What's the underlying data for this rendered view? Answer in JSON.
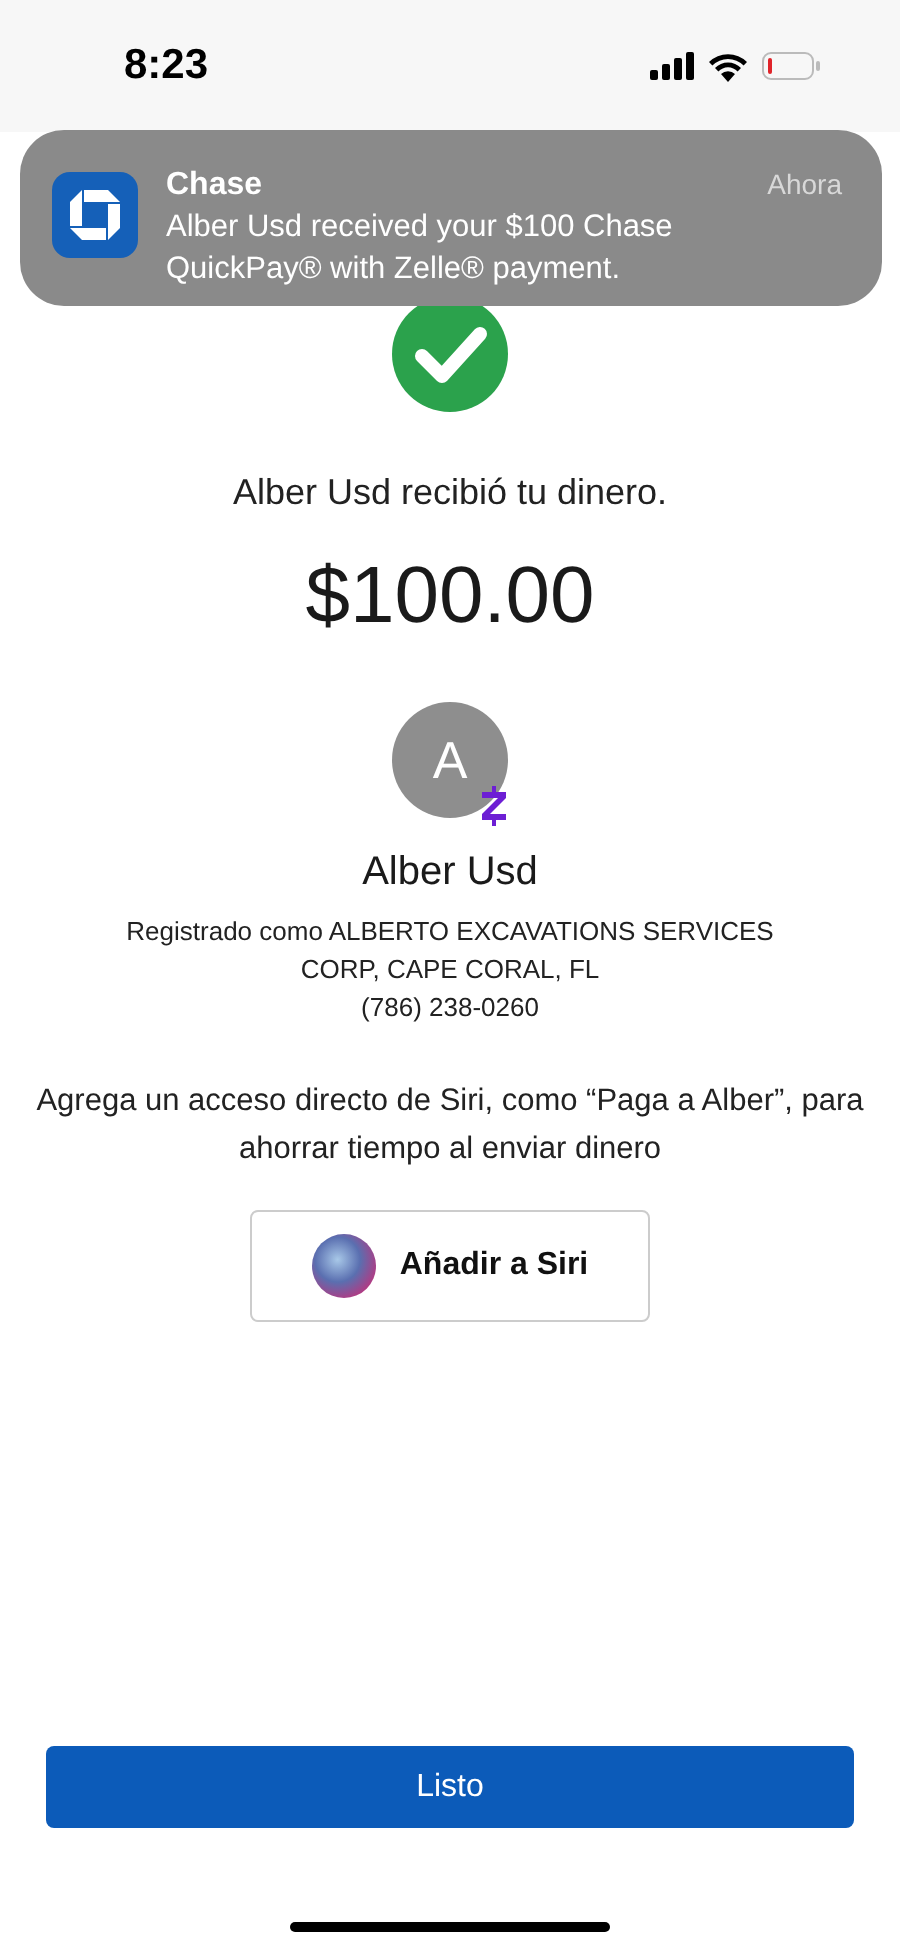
{
  "status_bar": {
    "time": "8:23"
  },
  "notification": {
    "app": "Chase",
    "time": "Ahora",
    "message": "Alber Usd received your $100 Chase QuickPay® with Zelle® payment."
  },
  "confirmation": {
    "message": "Alber Usd recibió tu dinero.",
    "amount": "$100.00"
  },
  "recipient": {
    "initial": "A",
    "name": "Alber Usd",
    "registered": "Registrado como ALBERTO EXCAVATIONS SERVICES CORP, CAPE CORAL, FL",
    "phone": "(786) 238-0260"
  },
  "siri": {
    "prompt": "Agrega un acceso directo de Siri, como “Paga a Alber”, para ahorrar tiempo al enviar dinero",
    "button": "Añadir a Siri"
  },
  "done_button": "Listo"
}
